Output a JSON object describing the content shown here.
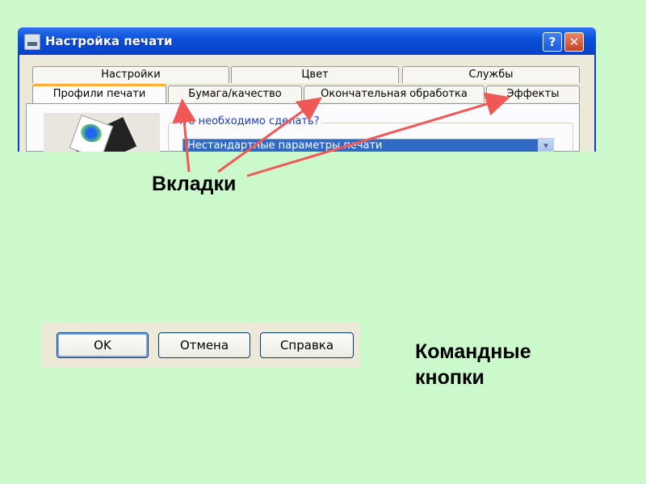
{
  "dialog": {
    "title": "Настройка печати",
    "help_symbol": "?",
    "close_symbol": "✕",
    "tabs_row_back": [
      "Настройки",
      "Цвет",
      "Службы"
    ],
    "tabs_row_front": [
      "Профили печати",
      "Бумага/качество",
      "Окончательная обработка",
      "Эффекты"
    ],
    "active_tab": "Профили печати",
    "group_label": "Что необходимо сделать?",
    "profile_select_value": "Нестандартные параметры печати",
    "combo_arrow": "▾"
  },
  "annotations": {
    "tabs_label": "Вкладки",
    "buttons_label_line1": "Командные",
    "buttons_label_line2": "кнопки"
  },
  "buttons": {
    "ok": "OK",
    "cancel": "Отмена",
    "help": "Справка"
  },
  "colors": {
    "background": "#ccf9cc",
    "arrow": "#f05858",
    "titlebar": "#0a4fd8"
  }
}
